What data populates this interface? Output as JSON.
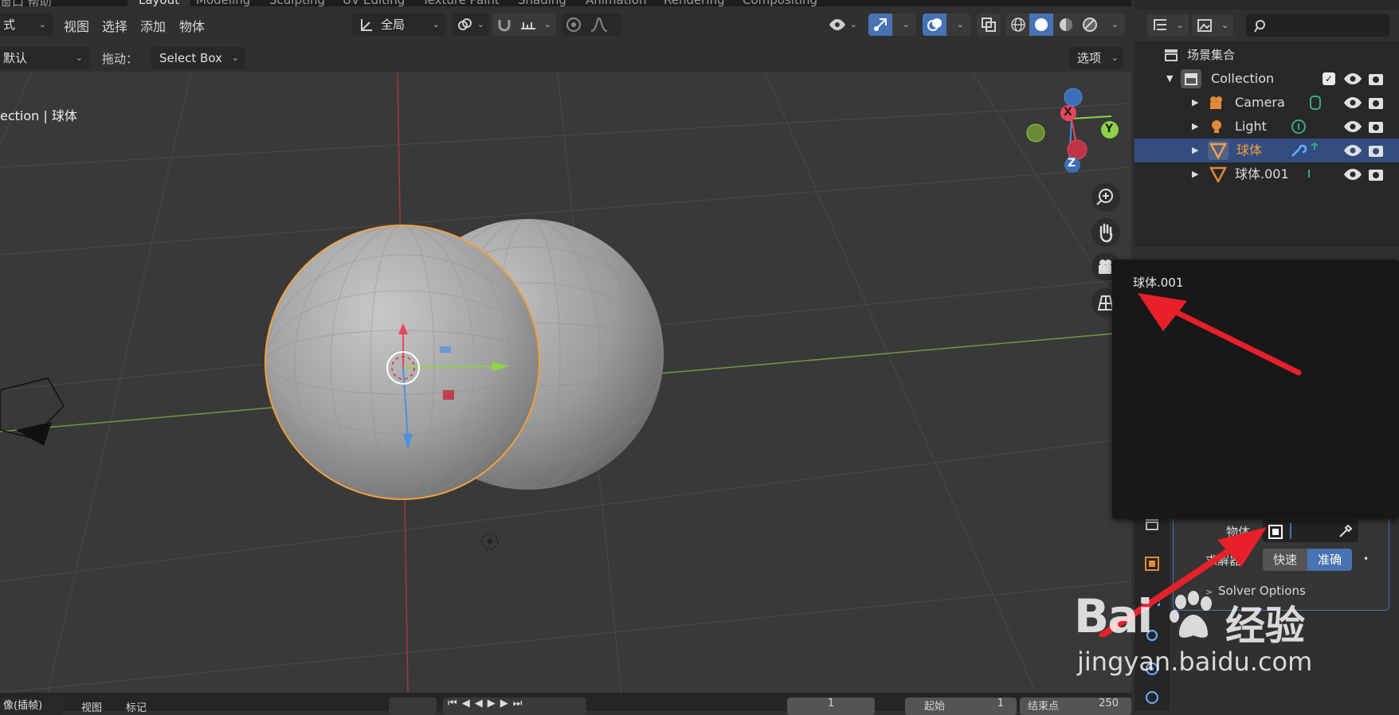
{
  "workspace_tabs": [
    "Layout",
    "Modeling",
    "Sculpting",
    "UV Editing",
    "Texture Paint",
    "Shading",
    "Animation",
    "Rendering",
    "Compositing"
  ],
  "header": {
    "mode_label": "式",
    "menus": [
      "视图",
      "选择",
      "添加",
      "物体"
    ],
    "transform_orientation": "全局",
    "orientation_label_default": "默认",
    "drag_label": "拖动：",
    "select_box": "Select Box",
    "options_label": "选项"
  },
  "viewport": {
    "overlay_line1": "",
    "overlay_line2": "ection | 球体",
    "gizmo_axes": [
      "X",
      "Y",
      "Z"
    ],
    "axis_colors": {
      "x": "#e8455a",
      "y": "#8cd147",
      "z": "#4b8fe0"
    }
  },
  "outliner": {
    "scene_collection": "场景集合",
    "items": [
      {
        "label": "Collection",
        "type": "collection"
      },
      {
        "label": "Camera",
        "type": "camera"
      },
      {
        "label": "Light",
        "type": "light"
      },
      {
        "label": "球体",
        "type": "mesh",
        "selected": true
      },
      {
        "label": "球体.001",
        "type": "mesh"
      }
    ]
  },
  "tooltip": {
    "text": "球体.001"
  },
  "properties": {
    "object_label": "物体",
    "solver_label": "求解器",
    "solver_fast": "快速",
    "solver_exact": "准确",
    "solver_options": "Solver Options"
  },
  "timeline": {
    "playback_label": "像(插帧)",
    "view_label": "视图",
    "marker_label": "标记",
    "current_frame": "1",
    "start_label": "起始",
    "start_frame": "1",
    "end_label": "结束点",
    "end_frame": "250"
  },
  "watermark": {
    "brand": "Bai",
    "brand2": "经验",
    "url": "jingyan.baidu.com"
  },
  "colors": {
    "accent": "#4772b3",
    "selection": "#334d80",
    "active_object": "#f0a040"
  }
}
